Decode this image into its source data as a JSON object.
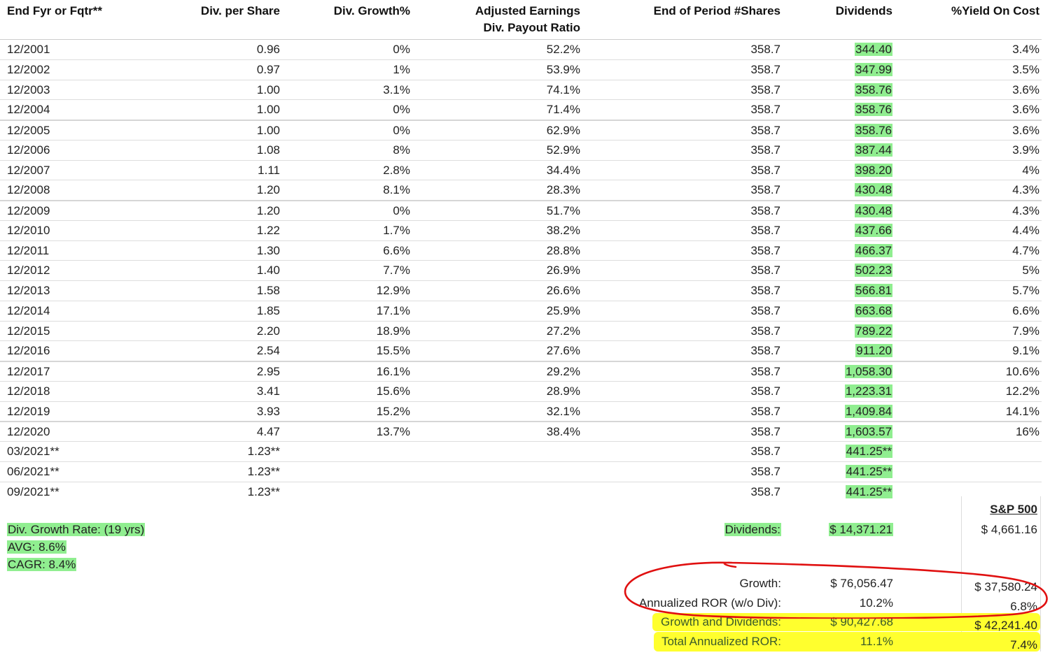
{
  "headers": {
    "year": "End Fyr or Fqtr**",
    "dps": "Div. per Share",
    "growth": "Div. Growth%",
    "payout_line1": "Adjusted Earnings",
    "payout_line2": "Div. Payout Ratio",
    "shares": "End of Period #Shares",
    "dividends": "Dividends",
    "yield": "%Yield On Cost"
  },
  "rows": [
    {
      "year": "12/2001",
      "dps": "0.96",
      "growth": "0%",
      "payout": "52.2%",
      "shares": "358.7",
      "dividends": "344.40",
      "yield": "3.4%"
    },
    {
      "year": "12/2002",
      "dps": "0.97",
      "growth": "1%",
      "payout": "53.9%",
      "shares": "358.7",
      "dividends": "347.99",
      "yield": "3.5%"
    },
    {
      "year": "12/2003",
      "dps": "1.00",
      "growth": "3.1%",
      "payout": "74.1%",
      "shares": "358.7",
      "dividends": "358.76",
      "yield": "3.6%"
    },
    {
      "year": "12/2004",
      "dps": "1.00",
      "growth": "0%",
      "payout": "71.4%",
      "shares": "358.7",
      "dividends": "358.76",
      "yield": "3.6%"
    },
    {
      "year": "12/2005",
      "dps": "1.00",
      "growth": "0%",
      "payout": "62.9%",
      "shares": "358.7",
      "dividends": "358.76",
      "yield": "3.6%"
    },
    {
      "year": "12/2006",
      "dps": "1.08",
      "growth": "8%",
      "payout": "52.9%",
      "shares": "358.7",
      "dividends": "387.44",
      "yield": "3.9%"
    },
    {
      "year": "12/2007",
      "dps": "1.11",
      "growth": "2.8%",
      "payout": "34.4%",
      "shares": "358.7",
      "dividends": "398.20",
      "yield": "4%"
    },
    {
      "year": "12/2008",
      "dps": "1.20",
      "growth": "8.1%",
      "payout": "28.3%",
      "shares": "358.7",
      "dividends": "430.48",
      "yield": "4.3%"
    },
    {
      "year": "12/2009",
      "dps": "1.20",
      "growth": "0%",
      "payout": "51.7%",
      "shares": "358.7",
      "dividends": "430.48",
      "yield": "4.3%"
    },
    {
      "year": "12/2010",
      "dps": "1.22",
      "growth": "1.7%",
      "payout": "38.2%",
      "shares": "358.7",
      "dividends": "437.66",
      "yield": "4.4%"
    },
    {
      "year": "12/2011",
      "dps": "1.30",
      "growth": "6.6%",
      "payout": "28.8%",
      "shares": "358.7",
      "dividends": "466.37",
      "yield": "4.7%"
    },
    {
      "year": "12/2012",
      "dps": "1.40",
      "growth": "7.7%",
      "payout": "26.9%",
      "shares": "358.7",
      "dividends": "502.23",
      "yield": "5%"
    },
    {
      "year": "12/2013",
      "dps": "1.58",
      "growth": "12.9%",
      "payout": "26.6%",
      "shares": "358.7",
      "dividends": "566.81",
      "yield": "5.7%"
    },
    {
      "year": "12/2014",
      "dps": "1.85",
      "growth": "17.1%",
      "payout": "25.9%",
      "shares": "358.7",
      "dividends": "663.68",
      "yield": "6.6%"
    },
    {
      "year": "12/2015",
      "dps": "2.20",
      "growth": "18.9%",
      "payout": "27.2%",
      "shares": "358.7",
      "dividends": "789.22",
      "yield": "7.9%"
    },
    {
      "year": "12/2016",
      "dps": "2.54",
      "growth": "15.5%",
      "payout": "27.6%",
      "shares": "358.7",
      "dividends": "911.20",
      "yield": "9.1%"
    },
    {
      "year": "12/2017",
      "dps": "2.95",
      "growth": "16.1%",
      "payout": "29.2%",
      "shares": "358.7",
      "dividends": "1,058.30",
      "yield": "10.6%"
    },
    {
      "year": "12/2018",
      "dps": "3.41",
      "growth": "15.6%",
      "payout": "28.9%",
      "shares": "358.7",
      "dividends": "1,223.31",
      "yield": "12.2%"
    },
    {
      "year": "12/2019",
      "dps": "3.93",
      "growth": "15.2%",
      "payout": "32.1%",
      "shares": "358.7",
      "dividends": "1,409.84",
      "yield": "14.1%"
    },
    {
      "year": "12/2020",
      "dps": "4.47",
      "growth": "13.7%",
      "payout": "38.4%",
      "shares": "358.7",
      "dividends": "1,603.57",
      "yield": "16%"
    },
    {
      "year": "03/2021**",
      "dps": "1.23**",
      "growth": "",
      "payout": "",
      "shares": "358.7",
      "dividends": "441.25**",
      "yield": ""
    },
    {
      "year": "06/2021**",
      "dps": "1.23**",
      "growth": "",
      "payout": "",
      "shares": "358.7",
      "dividends": "441.25**",
      "yield": ""
    },
    {
      "year": "09/2021**",
      "dps": "1.23**",
      "growth": "",
      "payout": "",
      "shares": "358.7",
      "dividends": "441.25**",
      "yield": ""
    }
  ],
  "growth_summary": {
    "rate_label": "Div. Growth Rate: (19 yrs)",
    "avg": "AVG: 8.6%",
    "cagr": "CAGR: 8.4%"
  },
  "totals": {
    "sp500_title": "S&P 500",
    "dividends_label": "Dividends:",
    "dividends_value": "$ 14,371.21",
    "dividends_sp500": "$ 4,661.16",
    "growth_label": "Growth:",
    "growth_value": "$ 76,056.47",
    "growth_sp500": "$ 37,580.24",
    "ror_label": "Annualized ROR (w/o Div):",
    "ror_value": "10.2%",
    "ror_sp500": "6.8%",
    "gd_label": "Growth and Dividends:",
    "gd_value": "$ 90,427.68",
    "gd_sp500": "$ 42,241.40",
    "total_ror_label": "Total Annualized ROR:",
    "total_ror_value": "11.1%",
    "total_ror_sp500": "7.4%"
  },
  "colors": {
    "dividend_highlight": "#90ee90",
    "marker_yellow": "#ffff2e",
    "circle_red": "#e01010"
  }
}
